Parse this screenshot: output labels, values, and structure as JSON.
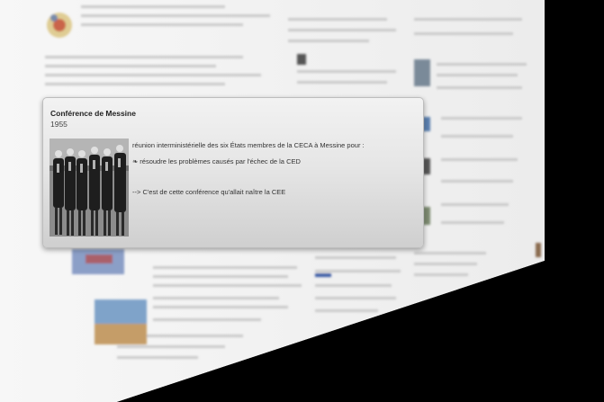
{
  "popup": {
    "title": "Conférence de Messine",
    "year": "1955",
    "intro": "réunion interministérielle des six États membres de la CECA à Messine pour :",
    "bullet_symbol": "❧",
    "item": "résoudre les problèmes causés par l'échec de la CED",
    "outro": "--> C'est de cette conférence qu'allait naître la CEE"
  },
  "colors": {
    "background": "#000000",
    "page": "#f4f4f4",
    "card_top": "#f2f2f2",
    "card_bottom": "#cfcfcf"
  },
  "icons": {
    "photo": "historical-group-photo",
    "bullet": "fleuron-icon"
  }
}
